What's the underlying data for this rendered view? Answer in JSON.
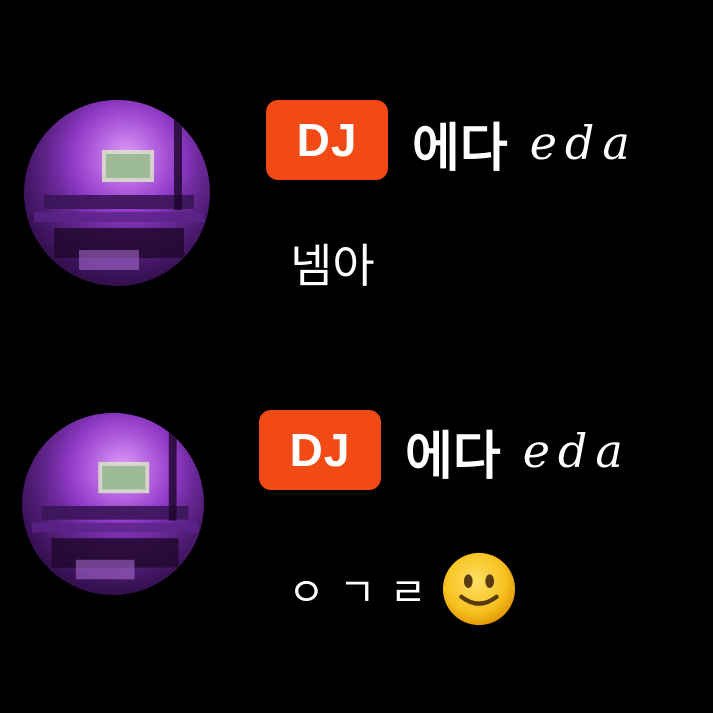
{
  "messages": [
    {
      "badge": "DJ",
      "name_ko": "에다",
      "name_en": "eda",
      "text": "넴아",
      "emoji": null
    },
    {
      "badge": "DJ",
      "name_ko": "에다",
      "name_en": "eda",
      "text": "ㅇㄱㄹ",
      "emoji": "slightly-smiling-face-emoji"
    }
  ],
  "colors": {
    "background": "#000000",
    "badge": "#f24a14",
    "text": "#ffffff",
    "avatar_tint": "#9b3fd4"
  }
}
